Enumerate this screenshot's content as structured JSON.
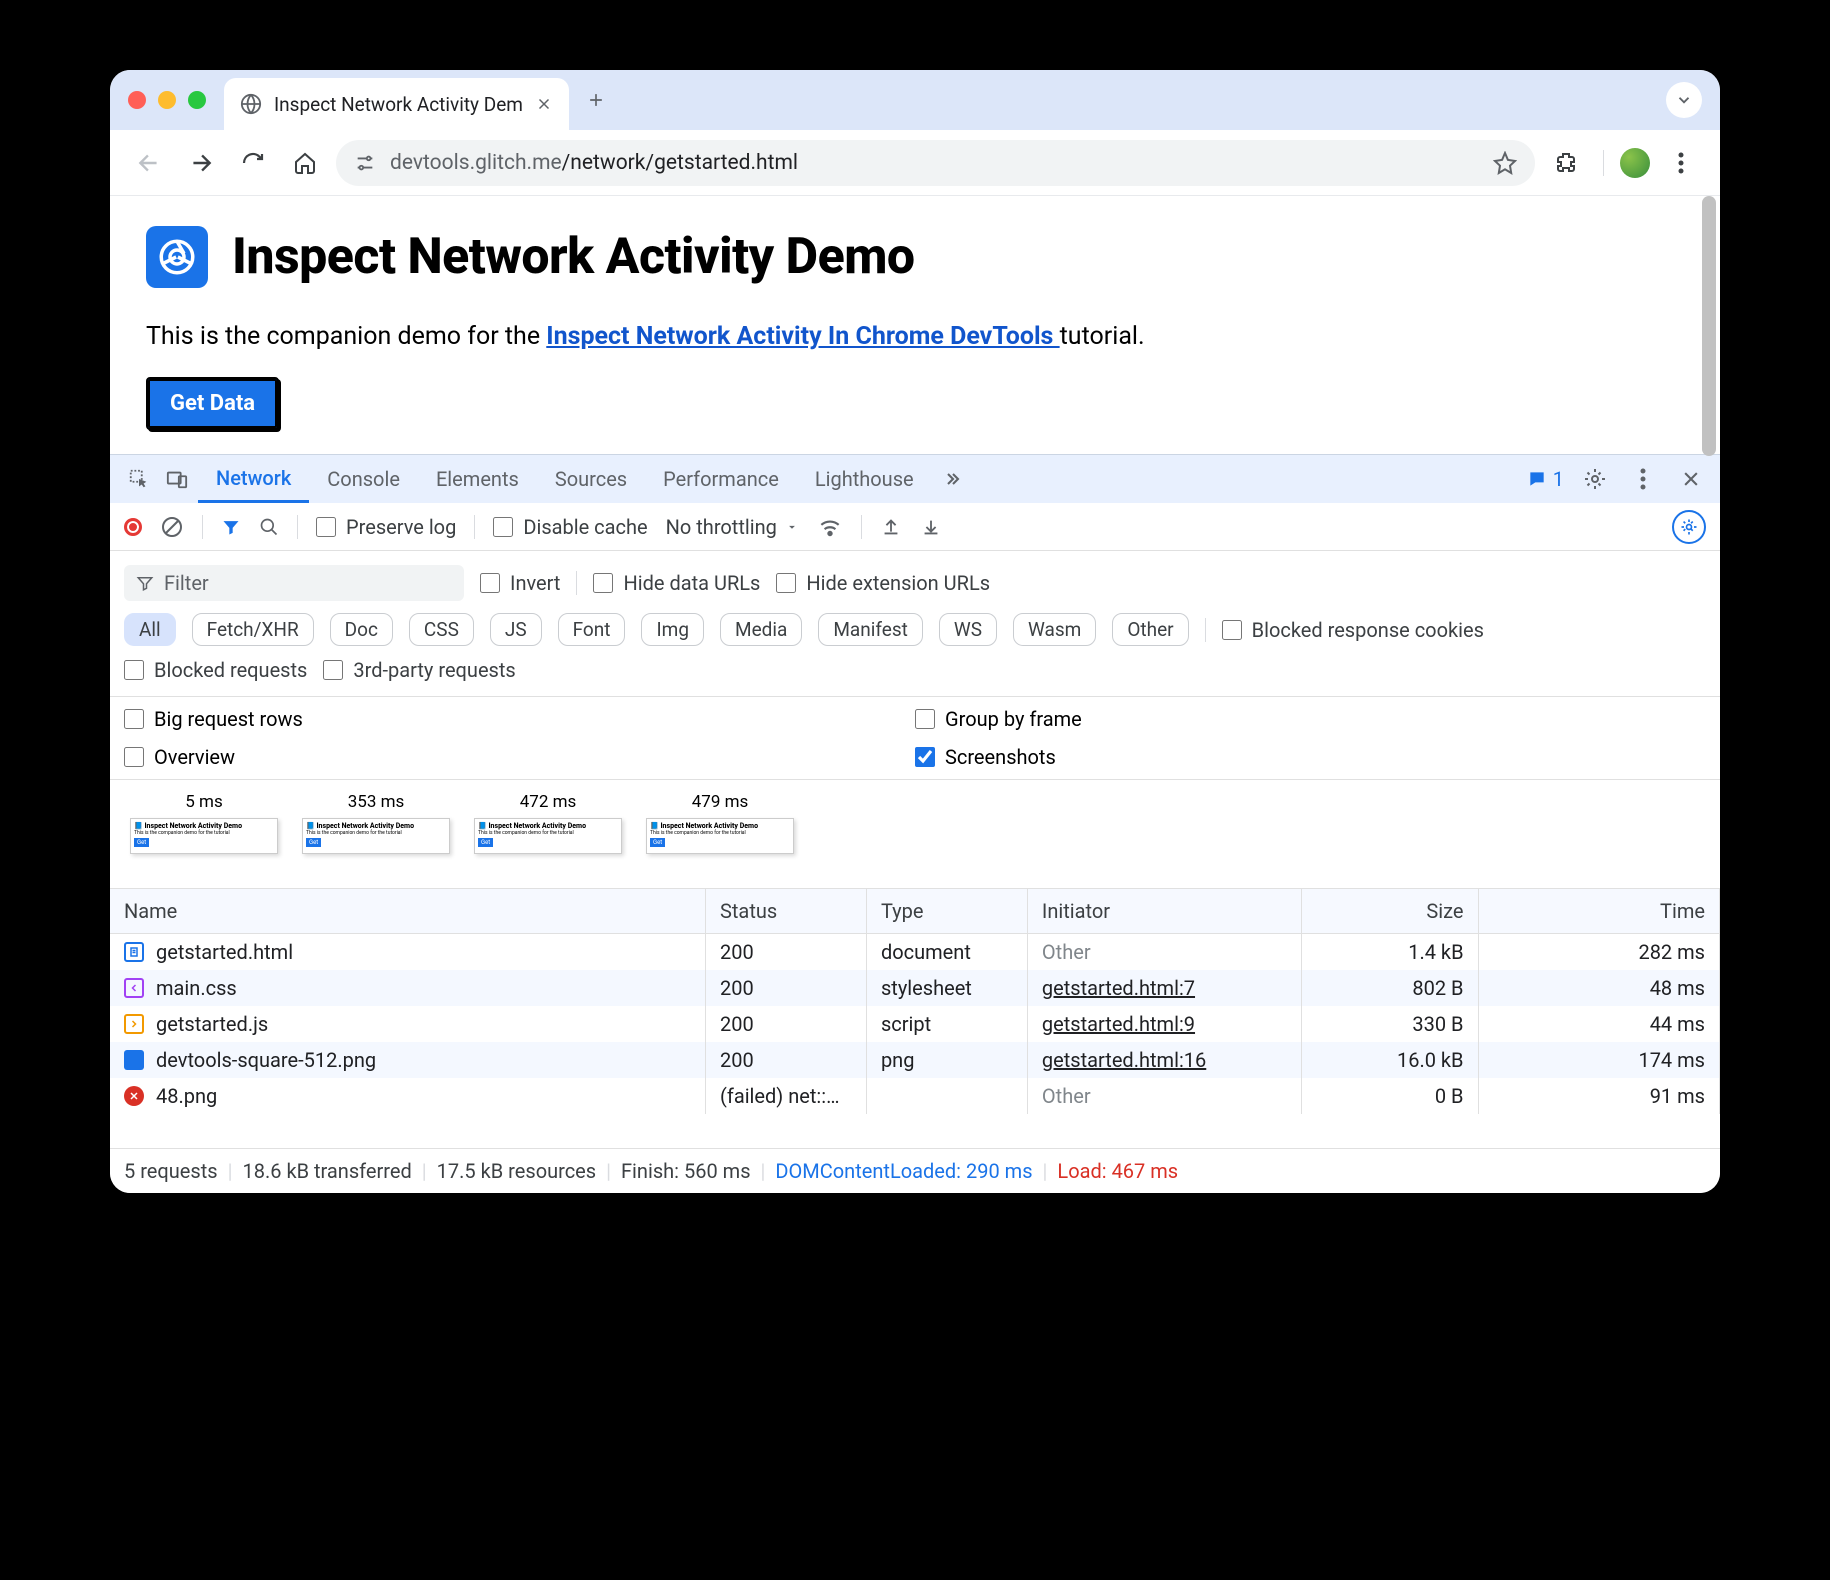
{
  "browser": {
    "tab_title": "Inspect Network Activity Dem",
    "url_host": "devtools.glitch.me",
    "url_path": "/network/getstarted.html"
  },
  "page": {
    "title": "Inspect Network Activity Demo",
    "desc_before": "This is the companion demo for the ",
    "desc_link": "Inspect Network Activity In Chrome DevTools ",
    "desc_after": "tutorial.",
    "button": "Get Data"
  },
  "devtools": {
    "tabs": [
      "Network",
      "Console",
      "Elements",
      "Sources",
      "Performance",
      "Lighthouse"
    ],
    "active_tab": "Network",
    "issues_count": "1",
    "toolbar": {
      "preserve_log": "Preserve log",
      "disable_cache": "Disable cache",
      "throttling": "No throttling"
    },
    "filter": {
      "placeholder": "Filter",
      "invert": "Invert",
      "hide_data_urls": "Hide data URLs",
      "hide_ext_urls": "Hide extension URLs",
      "types": [
        "All",
        "Fetch/XHR",
        "Doc",
        "CSS",
        "JS",
        "Font",
        "Img",
        "Media",
        "Manifest",
        "WS",
        "Wasm",
        "Other"
      ],
      "blocked_cookies": "Blocked response cookies",
      "blocked_requests": "Blocked requests",
      "third_party": "3rd-party requests"
    },
    "options": {
      "big_rows": "Big request rows",
      "overview": "Overview",
      "group_frame": "Group by frame",
      "screenshots": "Screenshots"
    },
    "screenshots": [
      "5 ms",
      "353 ms",
      "472 ms",
      "479 ms"
    ],
    "columns": [
      "Name",
      "Status",
      "Type",
      "Initiator",
      "Size",
      "Time"
    ],
    "rows": [
      {
        "icon": "doc",
        "name": "getstarted.html",
        "status": "200",
        "type": "document",
        "initiator": "Other",
        "initiator_link": false,
        "size": "1.4 kB",
        "time": "282 ms",
        "failed": false
      },
      {
        "icon": "css",
        "name": "main.css",
        "status": "200",
        "type": "stylesheet",
        "initiator": "getstarted.html:7",
        "initiator_link": true,
        "size": "802 B",
        "time": "48 ms",
        "failed": false
      },
      {
        "icon": "js",
        "name": "getstarted.js",
        "status": "200",
        "type": "script",
        "initiator": "getstarted.html:9",
        "initiator_link": true,
        "size": "330 B",
        "time": "44 ms",
        "failed": false
      },
      {
        "icon": "img",
        "name": "devtools-square-512.png",
        "status": "200",
        "type": "png",
        "initiator": "getstarted.html:16",
        "initiator_link": true,
        "size": "16.0 kB",
        "time": "174 ms",
        "failed": false
      },
      {
        "icon": "err",
        "name": "48.png",
        "status": "(failed) net::…",
        "type": "",
        "initiator": "Other",
        "initiator_link": false,
        "size": "0 B",
        "time": "91 ms",
        "failed": true
      }
    ],
    "status": {
      "requests": "5 requests",
      "transferred": "18.6 kB transferred",
      "resources": "17.5 kB resources",
      "finish": "Finish: 560 ms",
      "dcl": "DOMContentLoaded: 290 ms",
      "load": "Load: 467 ms"
    }
  }
}
